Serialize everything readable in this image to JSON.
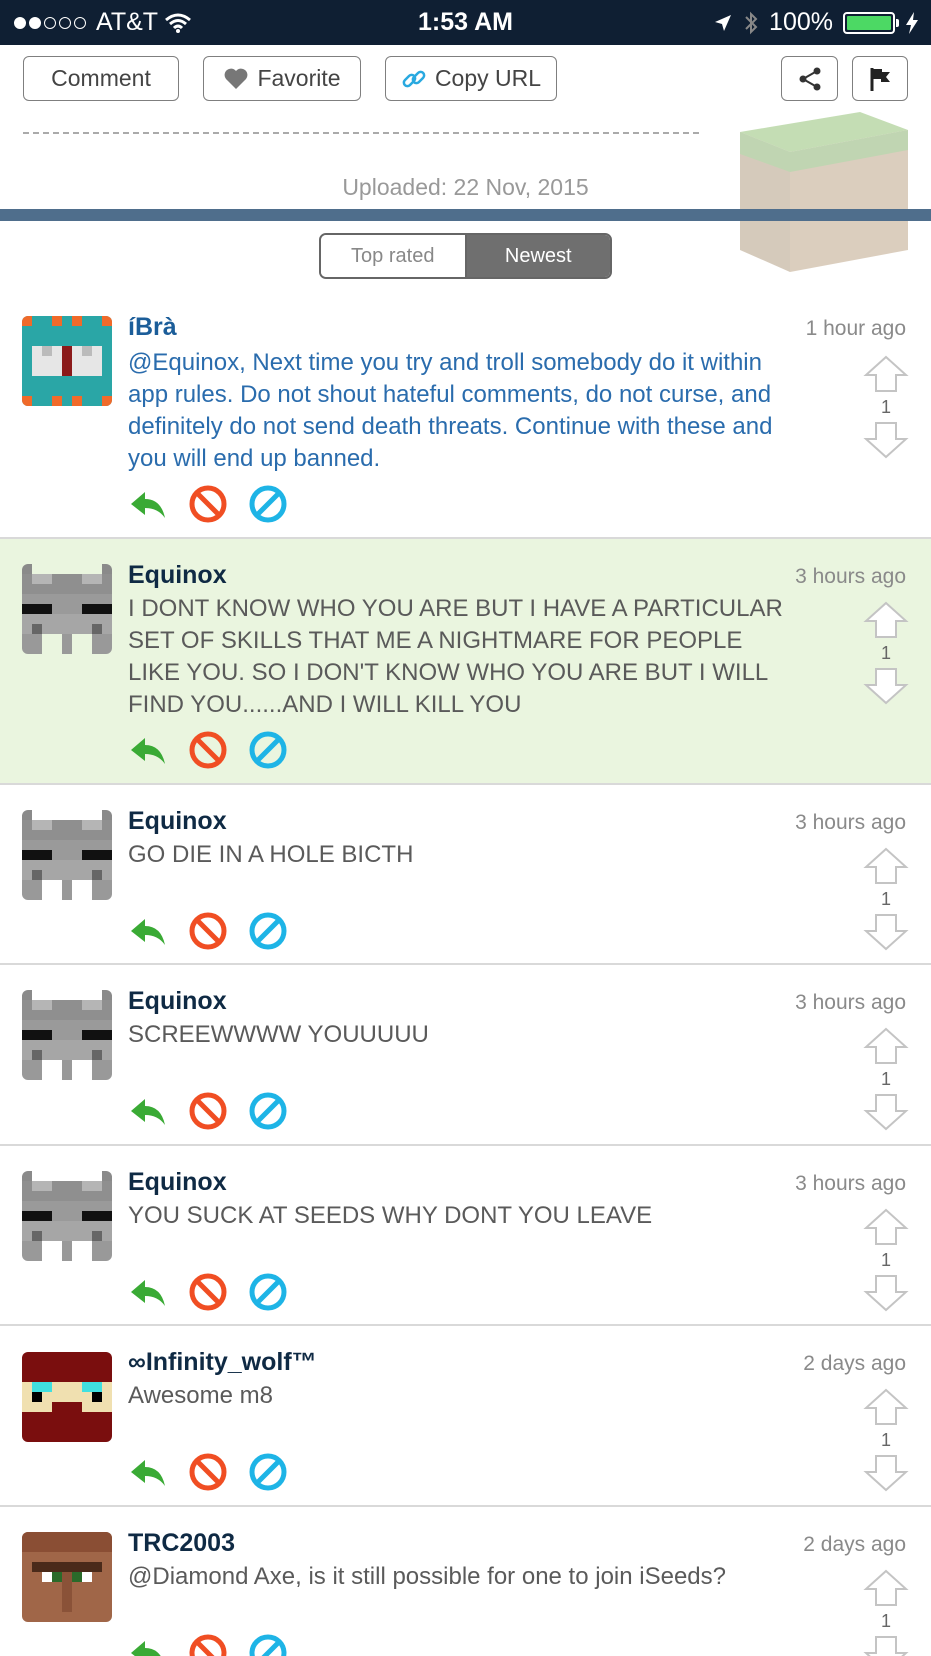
{
  "status_bar": {
    "carrier": "AT&T",
    "time": "1:53 AM",
    "battery": "100%"
  },
  "toolbar": {
    "comment_label": "Comment",
    "favorite_label": "Favorite",
    "copy_url_label": "Copy URL"
  },
  "uploaded": "Uploaded: 22 Nov, 2015",
  "sort": {
    "top_rated": "Top rated",
    "newest": "Newest",
    "selected": "Newest"
  },
  "comments": [
    {
      "user": "íBrà",
      "time": "1 hour ago",
      "text": "@Equinox, Next time you try and troll somebody do it within app rules. Do not shout hateful comments, do not curse, and definitely do not send death threats. Continue with these and you will end up banned.",
      "votes": "1"
    },
    {
      "user": "Equinox",
      "time": "3 hours ago",
      "text": "I DONT KNOW WHO YOU ARE BUT I HAVE A PARTICULAR SET OF SKILLS THAT ME A NIGHTMARE FOR PEOPLE LIKE YOU. SO I DON'T KNOW WHO YOU ARE BUT I WILL FIND YOU......AND I WILL KILL YOU",
      "votes": "1"
    },
    {
      "user": "Equinox",
      "time": "3 hours ago",
      "text": "GO DIE IN A HOLE BICTH",
      "votes": "1"
    },
    {
      "user": "Equinox",
      "time": "3 hours ago",
      "text": "SCREEWWWW YOUUUUU",
      "votes": "1"
    },
    {
      "user": "Equinox",
      "time": "3 hours ago",
      "text": "YOU SUCK AT SEEDS WHY DONT YOU LEAVE",
      "votes": "1"
    },
    {
      "user": "∞Infinity_wolf™",
      "time": "2 days ago",
      "text": "Awesome m8",
      "votes": "1"
    },
    {
      "user": "TRC2003",
      "time": "2 days ago",
      "text": "@Diamond Axe, is it still possible for one to join iSeeds?",
      "votes": "1"
    }
  ],
  "colors": {
    "status_bar_bg": "#0f1f33",
    "accent_blue": "#2a6cad",
    "highlight_bg": "#eaf5df",
    "reply_green": "#3aaa35",
    "block_red": "#f04e23",
    "ban_cyan": "#1eb4e6"
  }
}
